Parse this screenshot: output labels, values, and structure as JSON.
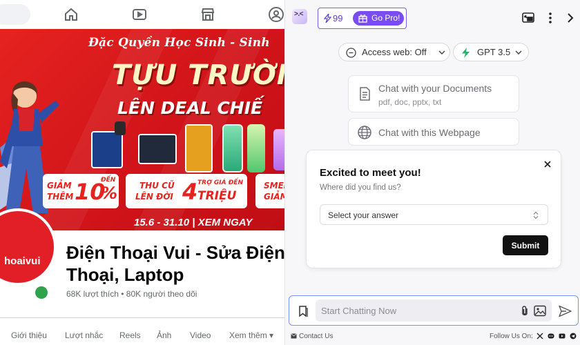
{
  "facebook": {
    "banner": {
      "top_text": "Đặc Quyền Học Sinh - Sinh",
      "big_text": "TỰU TRƯỜN",
      "mid_text": "LÊN DEAL CHIẾ",
      "promo1": {
        "line1": "GIẢM",
        "line2": "THÊM",
        "value": "10",
        "unit": "%",
        "sup": "ĐẾN"
      },
      "promo2": {
        "line1": "THU CŨ",
        "line2": "LÊN ĐỜI",
        "value": "4",
        "sup": "TRỢ GIÁ ĐẾN",
        "unit": "TRIỆU"
      },
      "promo3": {
        "line1": "SMEI",
        "line2": "GIẢM"
      },
      "date_cta": "15.6 - 31.10  |  XEM NGAY"
    },
    "avatar_text": "hoaivui",
    "page_name": "Điện Thoại Vui - Sửa Điện\nThoại, Laptop",
    "stats": "68K lượt thích • 80K người theo dõi",
    "tabs": [
      "Giới thiệu",
      "Lượt nhắc",
      "Reels",
      "Ảnh",
      "Video",
      "Xem thêm ▾"
    ],
    "nav_icons": [
      "home-icon",
      "video-icon",
      "marketplace-icon",
      "groups-icon"
    ]
  },
  "sidebar": {
    "logo_face": ">.<",
    "credits": "99",
    "gopro_label": "Go Pro!",
    "access_web": "Access web: Off",
    "model": "GPT 3.5",
    "docs_card": {
      "title": "Chat with your Documents",
      "subtitle": "pdf, doc, pptx, txt"
    },
    "webpage_card": {
      "title": "Chat with this Webpage"
    },
    "survey": {
      "title": "Excited to meet you!",
      "subtitle": "Where did you find us?",
      "select_value": "Select your answer",
      "submit_label": "Submit"
    },
    "composer": {
      "placeholder": "Start Chatting Now"
    },
    "footer": {
      "contact": "Contact Us",
      "follow": "Follow Us On:"
    },
    "colors": {
      "accent": "#7a4cf4",
      "dark_button": "#121212",
      "composer_border": "#7e93f0"
    }
  }
}
